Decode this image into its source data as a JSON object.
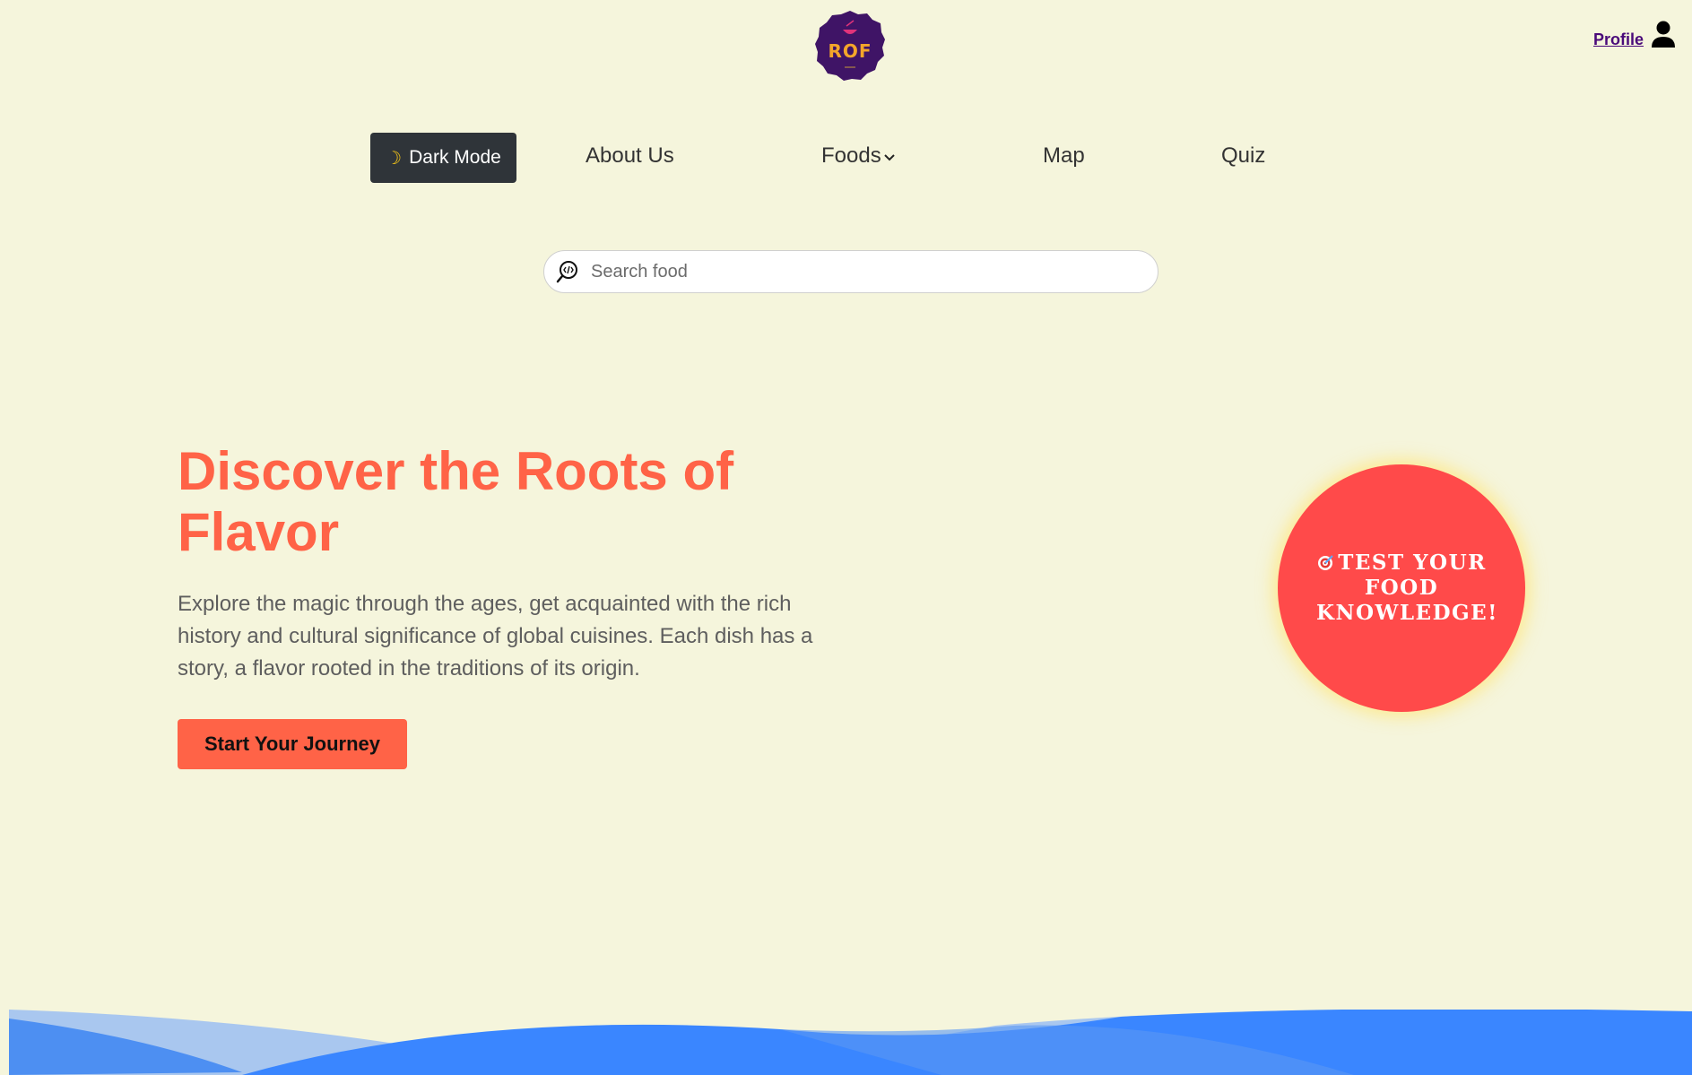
{
  "header": {
    "logo_text": "ROF",
    "profile_label": "Profile"
  },
  "nav": {
    "dark_mode_label": "Dark Mode",
    "about_label": "About Us",
    "foods_label": "Foods",
    "map_label": "Map",
    "quiz_label": "Quiz"
  },
  "search": {
    "placeholder": "Search food",
    "value": ""
  },
  "hero": {
    "title": "Discover the Roots of Flavor",
    "description": "Explore the magic through the ages, get acquainted with the rich history and cultural significance of global cuisines. Each dish has a story, a flavor rooted in the traditions of its origin.",
    "cta_label": "Start Your Journey"
  },
  "quiz_badge": {
    "label": "TEST YOUR FOOD KNOWLEDGE!"
  },
  "colors": {
    "background": "#f5f5dc",
    "accent": "#ff6347",
    "quiz_circle": "#ff4a4a",
    "dark_button": "#2f3439",
    "logo_bg": "#3f1466",
    "wave": "#3a86ff"
  },
  "icons": {
    "logo": "rof-logo",
    "profile": "user-icon",
    "dark_mode": "moon-icon",
    "foods_dropdown": "chevron-down-icon",
    "search": "search-icon",
    "quiz": "target-icon"
  }
}
